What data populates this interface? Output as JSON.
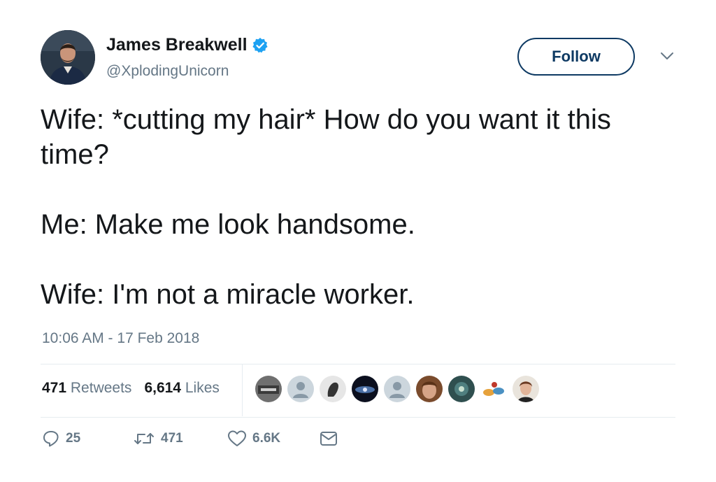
{
  "user": {
    "name": "James Breakwell",
    "handle": "@XplodingUnicorn",
    "verified_icon": "verified-badge-icon",
    "avatar_icon": "user-avatar"
  },
  "follow_button": {
    "label": "Follow"
  },
  "tweet": {
    "lines": [
      "Wife: *cutting my hair* How do you want it this time?",
      "Me: Make me look handsome.",
      "Wife: I'm not a miracle worker."
    ],
    "timestamp": "10:06 AM - 17 Feb 2018"
  },
  "stats": {
    "retweets_count": "471",
    "retweets_label": "Retweets",
    "likes_count": "6,614",
    "likes_label": "Likes"
  },
  "likers": [
    "liker-avatar-1",
    "liker-avatar-2",
    "liker-avatar-3",
    "liker-avatar-4",
    "liker-avatar-5",
    "liker-avatar-6",
    "liker-avatar-7",
    "liker-avatar-8",
    "liker-avatar-9"
  ],
  "actions": {
    "reply_count": "25",
    "retweet_count": "471",
    "like_count": "6.6K"
  },
  "colors": {
    "text": "#14171a",
    "secondary": "#657786",
    "verified": "#1da1f2",
    "follow_border": "#0e3a63",
    "divider": "#e6ecf0"
  }
}
